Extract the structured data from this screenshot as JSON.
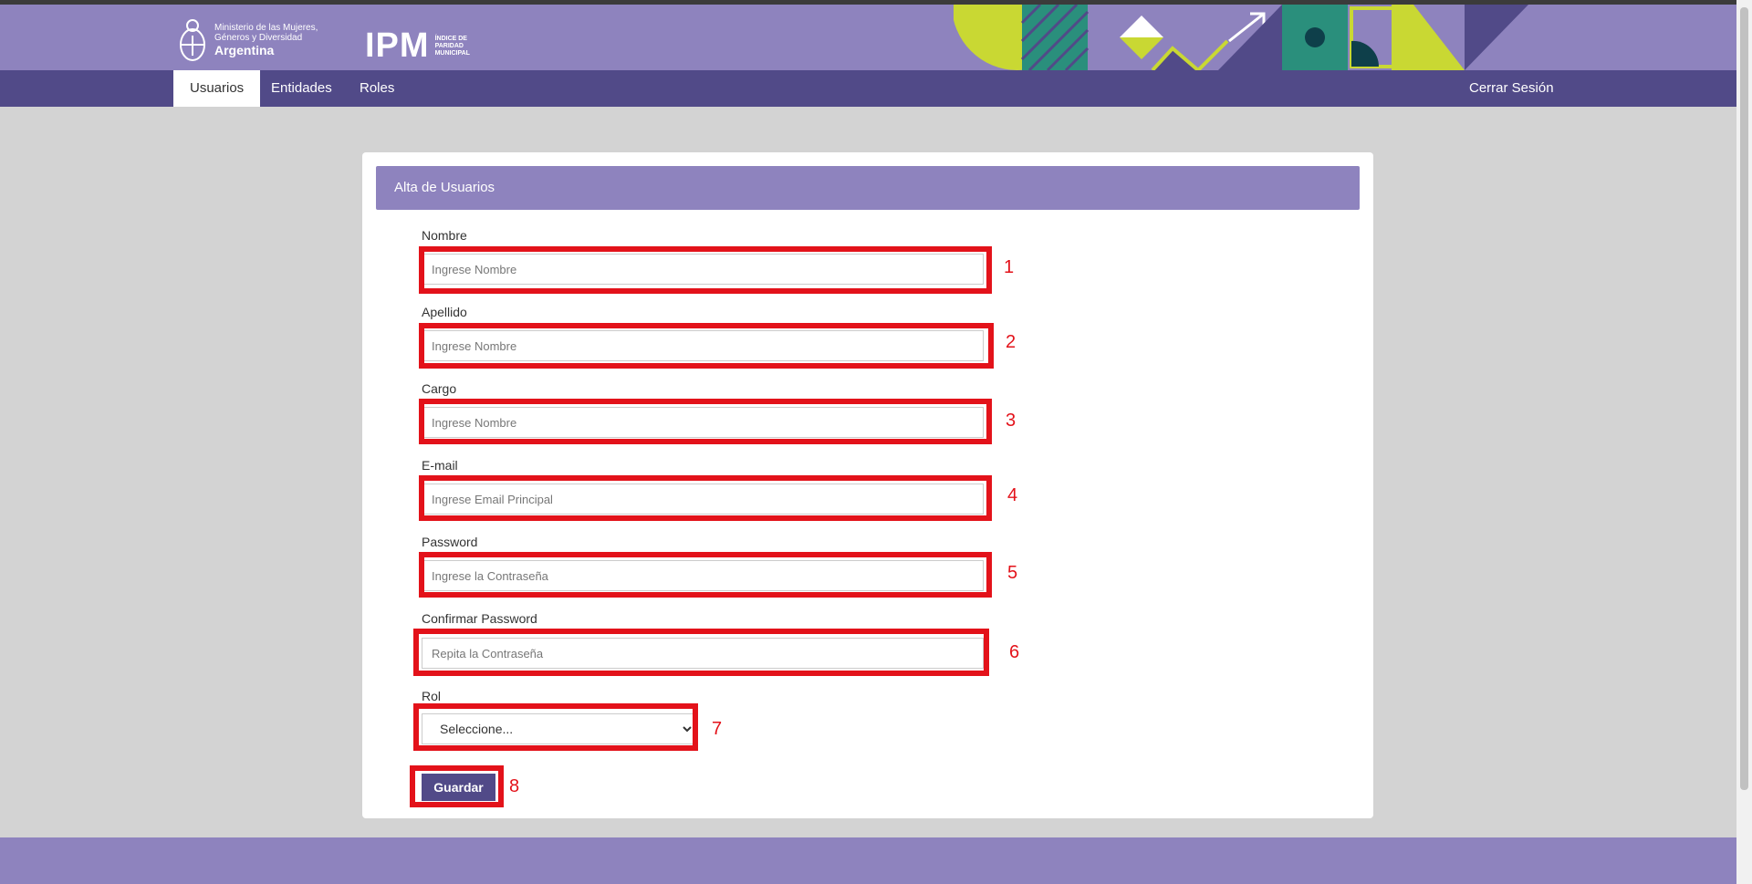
{
  "header": {
    "ministry": {
      "line1": "Ministerio de las Mujeres,",
      "line2": "Géneros y Diversidad",
      "line3": "Argentina"
    },
    "ipm_logo": {
      "big": "IPM",
      "line1": "ÍNDICE DE",
      "line2": "PARIDAD",
      "line3": "MUNICIPAL"
    }
  },
  "nav": {
    "items": [
      {
        "label": "Usuarios"
      },
      {
        "label": "Entidades"
      },
      {
        "label": "Roles"
      }
    ],
    "logout": "Cerrar Sesión"
  },
  "card": {
    "title": "Alta de Usuarios"
  },
  "form": {
    "fields": [
      {
        "label": "Nombre",
        "placeholder": "Ingrese Nombre"
      },
      {
        "label": "Apellido",
        "placeholder": "Ingrese Nombre"
      },
      {
        "label": "Cargo",
        "placeholder": "Ingrese Nombre"
      },
      {
        "label": "E-mail",
        "placeholder": "Ingrese Email Principal"
      },
      {
        "label": "Password",
        "placeholder": "Ingrese la Contraseña"
      },
      {
        "label": "Confirmar Password",
        "placeholder": "Repita la Contraseña"
      }
    ],
    "role": {
      "label": "Rol",
      "selected": "Seleccione..."
    },
    "save_label": "Guardar"
  },
  "annotations": [
    "1",
    "2",
    "3",
    "4",
    "5",
    "6",
    "7",
    "8"
  ],
  "colors": {
    "header": "#8e83be",
    "nav": "#514a88",
    "annotation": "#e3121a",
    "background": "#d3d3d3"
  }
}
